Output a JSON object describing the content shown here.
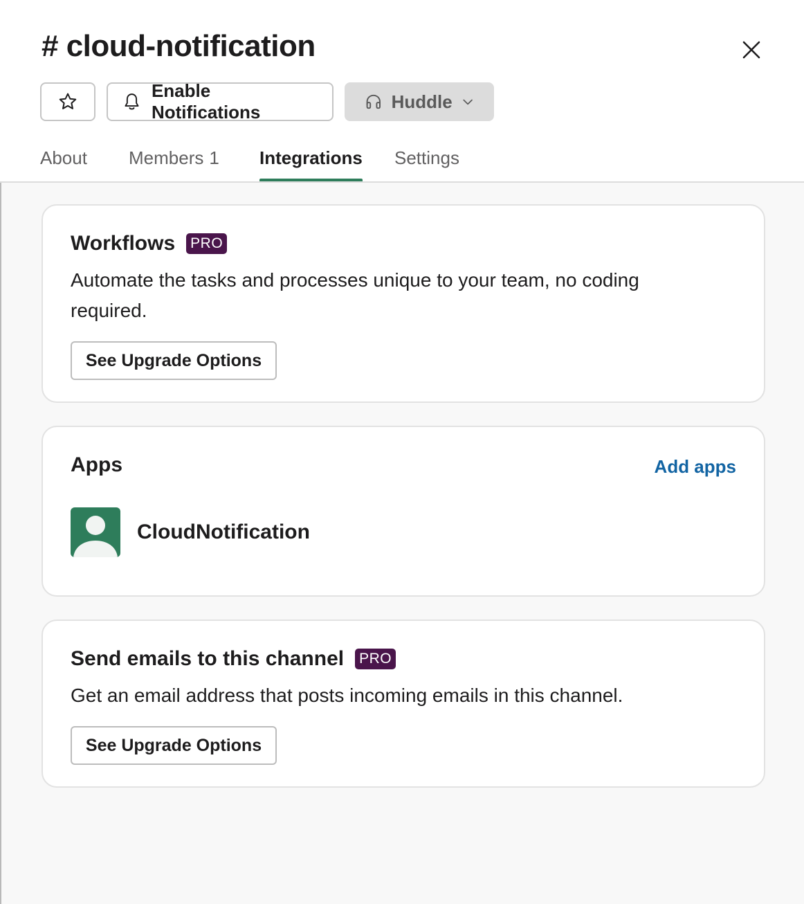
{
  "channel": {
    "title": "# cloud-notification"
  },
  "actions": {
    "notifications_label": "Enable Notifications",
    "huddle_label": "Huddle"
  },
  "tabs": [
    {
      "label": "About"
    },
    {
      "label": "Members",
      "count": "1"
    },
    {
      "label": "Integrations",
      "active": true
    },
    {
      "label": "Settings"
    }
  ],
  "workflows": {
    "title": "Workflows",
    "badge": "PRO",
    "description": "Automate the tasks and processes unique to your team, no coding required.",
    "button_label": "See Upgrade Options"
  },
  "apps": {
    "title": "Apps",
    "add_label": "Add apps",
    "items": [
      {
        "name": "CloudNotification",
        "avatar_color": "#2e7d5b"
      }
    ]
  },
  "emails": {
    "title": "Send emails to this channel",
    "badge": "PRO",
    "description": "Get an email address that posts incoming emails in this channel.",
    "button_label": "See Upgrade Options"
  },
  "colors": {
    "accent_tab": "#2e7d5b",
    "pro_badge": "#4a154b",
    "link": "#1264a3"
  }
}
